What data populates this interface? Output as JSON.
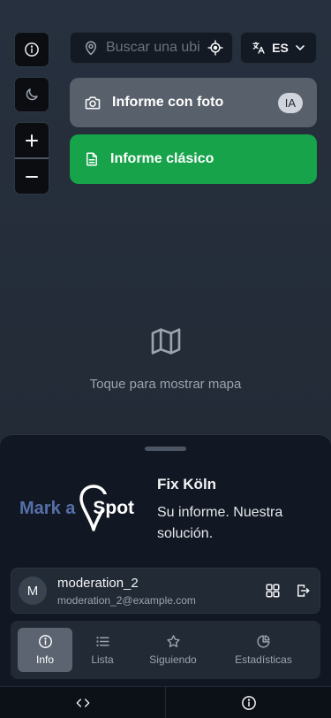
{
  "search": {
    "placeholder": "Buscar una ubicación"
  },
  "language": {
    "selected": "ES"
  },
  "actions": {
    "photo_report_label": "Informe con foto",
    "ai_badge": "IA",
    "classic_report_label": "Informe clásico"
  },
  "map": {
    "hint": "Toque para mostrar mapa"
  },
  "brand": {
    "logo_text": "Mark a",
    "logo_spot": "Spot"
  },
  "app": {
    "title": "Fix Köln",
    "slogan": "Su informe. Nuestra solución."
  },
  "user": {
    "initial": "M",
    "name": "moderation_2",
    "email": "moderation_2@example.com"
  },
  "tabs": [
    {
      "label": "Info",
      "icon": "info-icon",
      "active": true
    },
    {
      "label": "Lista",
      "icon": "list-icon"
    },
    {
      "label": "Siguiendo",
      "icon": "star-icon"
    },
    {
      "label": "Estadísticas",
      "icon": "pie-chart-icon"
    }
  ],
  "bottom_bar": [
    "code-icon",
    "info-icon"
  ],
  "colors": {
    "accent_green": "#16a34a",
    "panel": "#121823",
    "brand_blue": "#5570a8"
  }
}
